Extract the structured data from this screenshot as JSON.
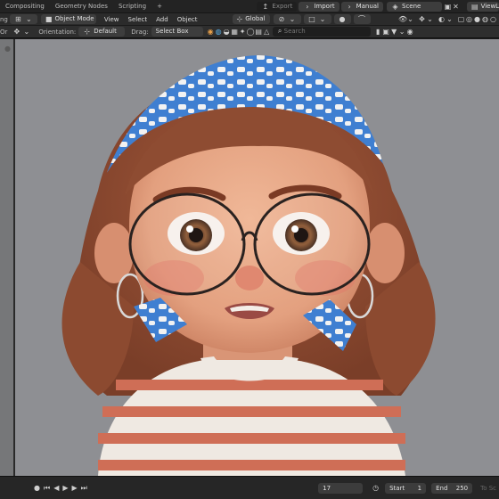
{
  "workspaces": [
    "Compositing",
    "Geometry Nodes",
    "Scripting"
  ],
  "add_workspace": "+",
  "top_right": {
    "export": "Export",
    "import": "Import",
    "manual": "Manual",
    "scene": "Scene",
    "view_layer": "ViewL"
  },
  "header": {
    "edge_left": "ng",
    "mode": "Object Mode",
    "menus": [
      "View",
      "Select",
      "Add",
      "Object"
    ],
    "transform_orientation": "Global"
  },
  "tool_header": {
    "edge_left": "Or",
    "orientation_label": "Orientation:",
    "orientation_value": "Default",
    "drag_label": "Drag:",
    "drag_value": "Select Box",
    "search_placeholder": "Search"
  },
  "timeline": {
    "current_frame": "17",
    "start_label": "Start",
    "start_value": "1",
    "end_label": "End",
    "end_value": "250",
    "edge_right": "To Sc"
  },
  "icons": [
    "viewport-icon",
    "move-tool-icon",
    "play-icon",
    "key-icon",
    "filter-icon",
    "shield-icon",
    "pin-icon"
  ],
  "colors": {
    "viewport_bg": "#8e8f93",
    "accent": "#3d7ee0"
  }
}
